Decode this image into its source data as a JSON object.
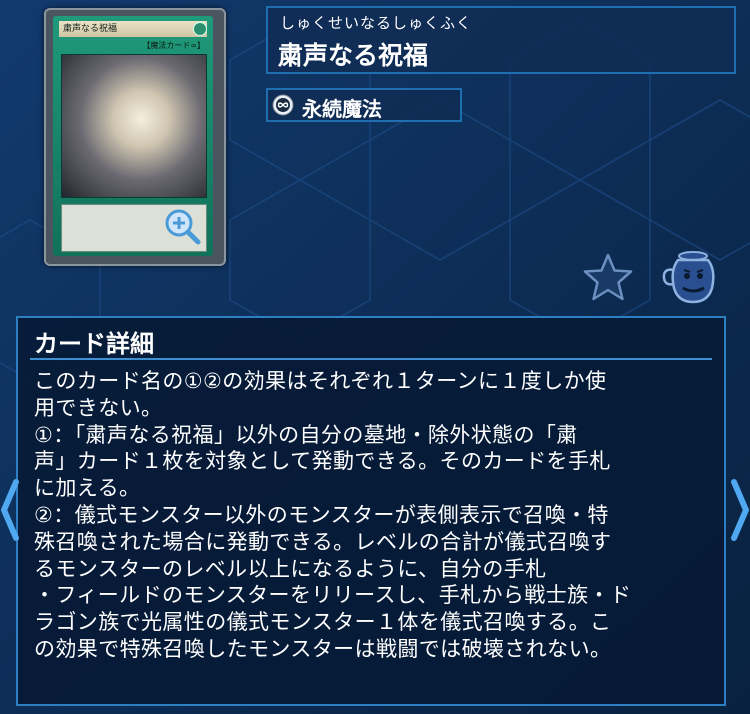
{
  "card": {
    "ruby": "しゅくせいなるしゅくふく",
    "name": "粛声なる祝福",
    "type_label": "永続魔法",
    "image": {
      "name_text": "粛声なる祝福",
      "type_text": "【魔法カード∞】"
    }
  },
  "icons": {
    "zoom": "zoom-in-icon",
    "type": "continuous-spell-icon",
    "favorite": "star-icon",
    "collection": "pot-icon",
    "prev": "chevron-left-icon",
    "next": "chevron-right-icon"
  },
  "detail": {
    "header": "カード詳細",
    "text": "このカード名の①②の効果はそれぞれ１ターンに１度しか使\n用できない。\n①：「粛声なる祝福」以外の自分の墓地・除外状態の「粛\n声」カード１枚を対象として発動できる。そのカードを手札\nに加える。\n②：儀式モンスター以外のモンスターが表側表示で召喚・特\n殊召喚された場合に発動できる。レベルの合計が儀式召喚す\nるモンスターのレベル以上になるように、自分の手札\n・フィールドのモンスターをリリースし、手札から戦士族・ド\nラゴン族で光属性の儀式モンスター１体を儀式召喚する。こ\nの効果で特殊召喚したモンスターは戦闘では破壊されない。"
  },
  "colors": {
    "background": "#0c2a52",
    "accent": "#2d7fc2",
    "card_frame": "#1f9a7a"
  }
}
